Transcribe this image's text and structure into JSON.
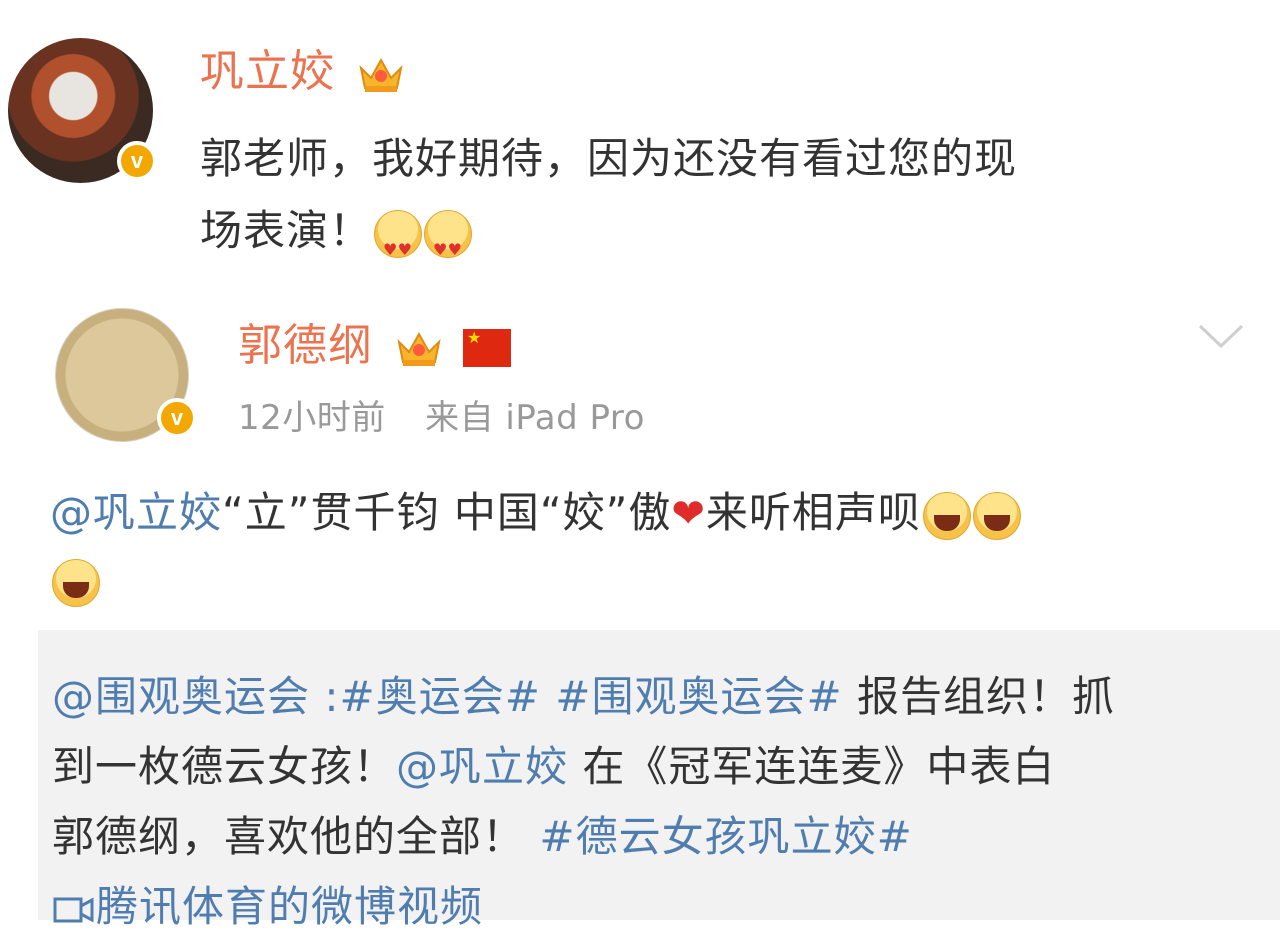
{
  "post": {
    "author": "巩立姣",
    "text_line1": "郭老师，我好期待，因为还没有看过您的现",
    "text_line2": "场表演！"
  },
  "reply": {
    "author": "郭德纲",
    "time": "12小时前",
    "source": "来自 iPad Pro",
    "mention": "@巩立姣",
    "text": "“立”贯千钧 中国“姣”傲",
    "text_after_heart": "来听相声呗"
  },
  "quote": {
    "mention1": "@围观奥运会",
    "sep": " :",
    "tag1": "#奥运会#",
    "tag2": "#围观奥运会#",
    "text1": " 报告组织！抓",
    "line2_text1": "到一枚德云女孩！",
    "mention2": "@巩立姣",
    "line2_text2": " 在《冠军连连麦》中表白",
    "line3_text": "郭德纲，喜欢他的全部！",
    "tag3": "#德云女孩巩立姣#",
    "video_label": "腾讯体育的微博视频"
  },
  "icons": {
    "verified": "verified-badge-icon",
    "crown": "vip-crown-icon",
    "flag": "china-flag-icon",
    "chevron": "chevron-down-icon",
    "video": "video-icon"
  },
  "colors": {
    "name": "#eb7350",
    "link": "#507daf",
    "meta": "#999999",
    "quote_bg": "#f2f2f2"
  }
}
